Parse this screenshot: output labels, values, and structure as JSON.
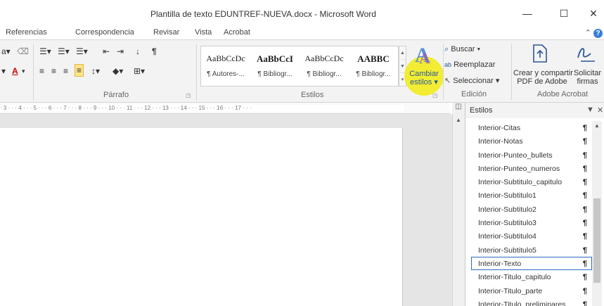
{
  "window": {
    "title": "Plantilla de texto EDUNTREF-NUEVA.docx - Microsoft Word",
    "minimize": "—",
    "maximize": "☐",
    "close": "✕",
    "help": "?"
  },
  "tabs": [
    "Referencias",
    "Correspondencia",
    "Revisar",
    "Vista",
    "Acrobat"
  ],
  "ribbon": {
    "parrafo_label": "Párrafo",
    "estilos_label": "Estilos",
    "edicion_label": "Edición",
    "adobe_label": "Adobe Acrobat",
    "gallery": [
      {
        "sample": "AaBbCcDc",
        "name": "¶ Autores-..."
      },
      {
        "sample": "AaBbCcI",
        "name": "¶ Bibliogr..."
      },
      {
        "sample": "AaBbCcDc",
        "name": "¶ Bibliogr..."
      },
      {
        "sample": "AABBC",
        "name": "¶ Bibliogr..."
      }
    ],
    "cambiar_estilos": [
      "Cambiar",
      "estilos ▾"
    ],
    "buscar": "Buscar ▾",
    "reemplazar": "Reemplazar",
    "seleccionar": "Seleccionar ▾",
    "crear_pdf": [
      "Crear y compartir",
      "PDF de Adobe"
    ],
    "solicitar": [
      "Solicitar",
      "firmas"
    ]
  },
  "ruler": {
    "text": "· 3 · · · 4 · · · 5 · · · 6 · · · 7 · · · 8 · · · 9 · · · 10 · · · 11 · · · 12 · · · 13 · · · 14 · · · 15 · · · 16 · · · 17 · · ·"
  },
  "styles_pane": {
    "title": "Estilos",
    "items": [
      "Interior-Citas",
      "Interior-Notas",
      "Interior-Punteo_bullets",
      "Interior-Punteo_numeros",
      "Interior-Subtitulo_capitulo",
      "Interior-Subtitulo1",
      "Interior-Subtitulo2",
      "Interior-Subtitulo3",
      "Interior-Subtitulo4",
      "Interior-Subtitulo5",
      "Interior-Texto",
      "Interior-Titulo_capitulo",
      "Interior-Titulo_parte",
      "Interior-Titulo_preliminares"
    ],
    "selected_index": 10,
    "pilcrow": "¶"
  },
  "colors": {
    "accent": "#2b579a",
    "highlight": "#f2ec1e",
    "selection": "#2b6cc4"
  }
}
